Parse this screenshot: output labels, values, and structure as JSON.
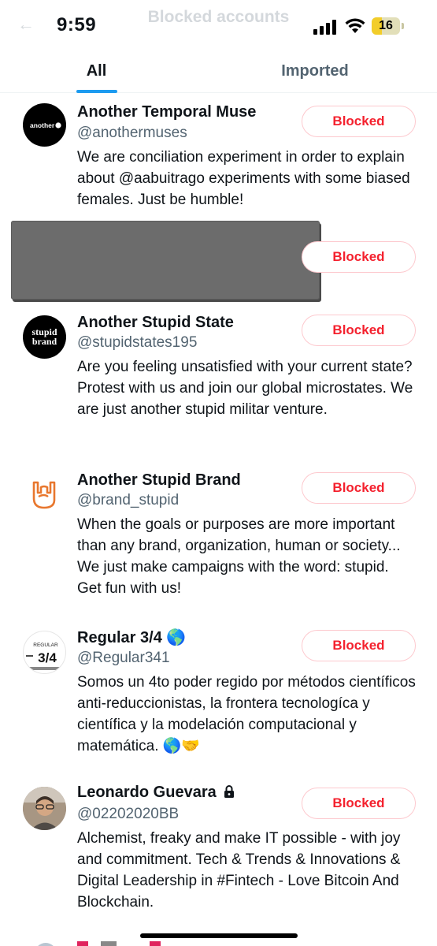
{
  "status_bar": {
    "time": "9:59",
    "battery_level": "16",
    "signal_icon": "cellular-signal-icon",
    "wifi_icon": "wifi-icon"
  },
  "header": {
    "title": "Blocked accounts",
    "back_icon": "back-arrow-icon"
  },
  "tabs": [
    {
      "label": "All",
      "active": true
    },
    {
      "label": "Imported",
      "active": false
    }
  ],
  "accent_color": "#1d9bf0",
  "blocked_color": "#f4212e",
  "accounts": [
    {
      "name": "Another Temporal Muse",
      "handle": "@anothermuses",
      "bio": "We are conciliation experiment in order to explain about @aabuitrago experiments with some biased females. Just be humble!",
      "button": "Blocked"
    },
    {
      "name": "",
      "handle": "",
      "bio": "",
      "button": "Blocked"
    },
    {
      "name": "Another Stupid State",
      "handle": "@stupidstates195",
      "bio": "Are you feeling unsatisfied with your current state? Protest with us and join our global microstates. We are just another stupid militar venture.",
      "button": "Blocked"
    },
    {
      "name": "Another Stupid Brand",
      "handle": "@brand_stupid",
      "bio": "When the goals or purposes are more important than any brand, organization, human or society... We just make campaigns with the word: stupid. Get fun with us!",
      "button": "Blocked"
    },
    {
      "name": "Regular 3/4 🌎",
      "handle": "@Regular341",
      "bio": "Somos un 4to poder regido por métodos científicos anti-reduccionistas, la frontera tecnologíca y científica y la modelación computacional y matemática. 🌎🤝",
      "button": "Blocked"
    },
    {
      "name": "Leonardo Guevara",
      "handle": "@02202020BB",
      "bio": "Alchemist, freaky and make IT possible - with joy and commitment. Tech & Trends & Innovations & Digital Leadership in #Fintech - Love Bitcoin And Blockchain.",
      "button": "Blocked"
    }
  ],
  "avatar_texts": {
    "muse": "another",
    "stupid_state": "stupid brand",
    "regular_small": "REGULAR",
    "regular_big": "3/4"
  }
}
